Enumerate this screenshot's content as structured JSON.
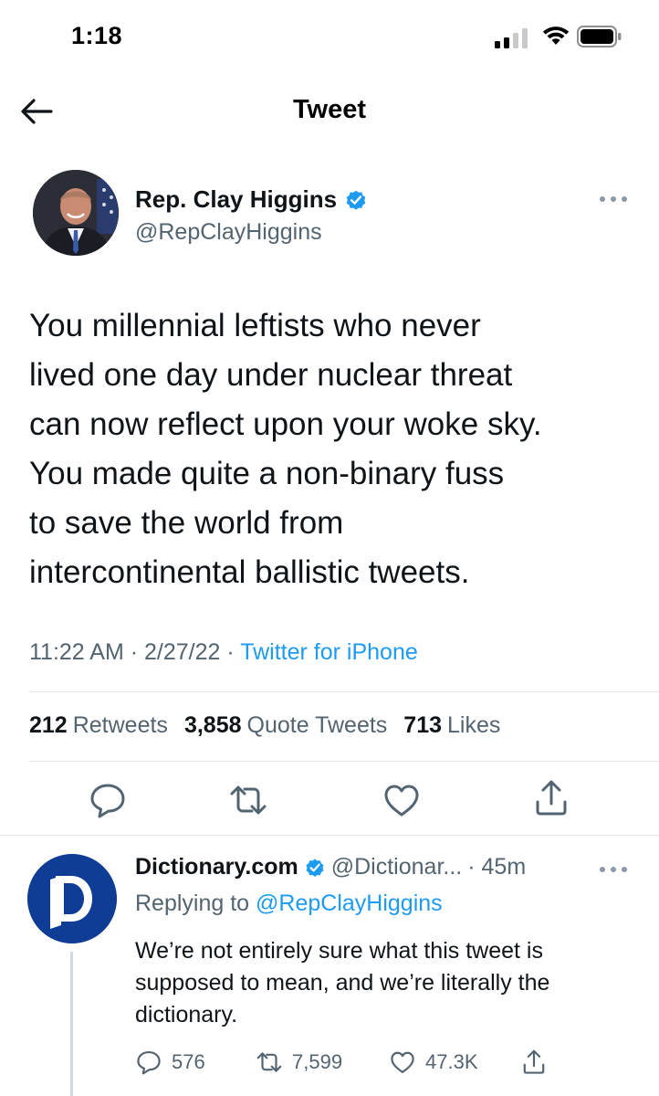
{
  "status_bar": {
    "time": "1:18"
  },
  "header": {
    "title": "Tweet"
  },
  "tweet": {
    "author_name": "Rep. Clay Higgins",
    "author_handle": "@RepClayHiggins",
    "text": "You millennial leftists who never\nlived one day under nuclear threat\ncan now reflect upon your woke sky.\n  You made quite a non-binary fuss\nto save the world from\nintercontinental ballistic tweets.",
    "time": "11:22 AM",
    "date": "2/27/22",
    "separator": "·",
    "source": "Twitter for iPhone",
    "stats": {
      "retweets_count": "212",
      "retweets_label": "Retweets",
      "quotes_count": "3,858",
      "quotes_label": "Quote Tweets",
      "likes_count": "713",
      "likes_label": "Likes"
    }
  },
  "reply": {
    "author_name": "Dictionary.com",
    "author_handle": "@Dictionar...",
    "time_ago": "· 45m",
    "replying_prefix": "Replying to",
    "replying_to": "@RepClayHiggins",
    "text": "We’re not entirely sure what this tweet is supposed to mean, and we’re literally the dictionary.",
    "replies": "576",
    "retweets": "7,599",
    "likes": "47.3K"
  },
  "colors": {
    "accent": "#1d9bf0",
    "text": "#0f1419",
    "secondary": "#536471",
    "dictionary_brand": "#0f3d96"
  },
  "icons": {
    "back": "arrow-left-icon",
    "verified": "verified-badge-icon",
    "more": "more-horizontal-icon",
    "reply": "reply-icon",
    "retweet": "retweet-icon",
    "like": "heart-icon",
    "share": "share-icon"
  }
}
